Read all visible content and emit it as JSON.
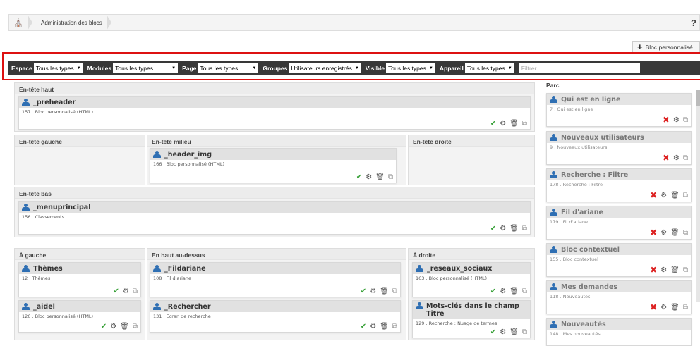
{
  "breadcrumb": {
    "item": "Administration des blocs",
    "help": "?"
  },
  "add_button": {
    "label": "Bloc personnalisé"
  },
  "filters": [
    {
      "label": "Espace",
      "value": "Tous les types"
    },
    {
      "label": "Modules",
      "value": "Tous les types"
    },
    {
      "label": "Page",
      "value": "Tous les types"
    },
    {
      "label": "Groupes",
      "value": "Utilisateurs enregistrés"
    },
    {
      "label": "Visible",
      "value": "Tous les types"
    },
    {
      "label": "Appareil",
      "value": "Tous les types"
    }
  ],
  "filter_placeholder": "Filtrer",
  "regions": {
    "top": "En-tête haut",
    "left_head": "En-tête gauche",
    "mid_head": "En-tête milieu",
    "right_head": "En-tête droite",
    "bottom_head": "En-tête bas",
    "left": "À gauche",
    "top_above": "En haut au-dessus",
    "right": "À droite",
    "parc": "Parc"
  },
  "blocks": {
    "preheader": {
      "title": "_preheader",
      "sub": "157 . Bloc personnalisé (HTML)"
    },
    "header_img": {
      "title": "_header_img",
      "sub": "166 . Bloc personnalisé (HTML)"
    },
    "menuprincipal": {
      "title": "_menuprincipal",
      "sub": "156 . Classements"
    },
    "themes": {
      "title": "Thèmes",
      "sub": "12 . Thèmes"
    },
    "aidel": {
      "title": "_aidel",
      "sub": "126 . Bloc personnalisé (HTML)"
    },
    "fildariane": {
      "title": "_Fildariane",
      "sub": "108 . Fil d'ariane"
    },
    "rechercher": {
      "title": "_Rechercher",
      "sub": "131 . Ecran de recherche"
    },
    "reseaux": {
      "title": "_reseaux_sociaux",
      "sub": "163 . Bloc personnalisé (HTML)"
    },
    "motscles": {
      "title": "Mots-clés dans le champ Titre",
      "sub": "129 . Recherche : Nuage de termes"
    }
  },
  "side": [
    {
      "title": "Qui est en ligne",
      "sub": "7 . Qui est en ligne"
    },
    {
      "title": "Nouveaux utilisateurs",
      "sub": "9 . Nouveaux utilisateurs"
    },
    {
      "title": "Recherche : Filtre",
      "sub": "178 . Recherche : Filtre"
    },
    {
      "title": "Fil d'ariane",
      "sub": "179 . Fil d'ariane"
    },
    {
      "title": "Bloc contextuel",
      "sub": "155 . Bloc contextuel"
    },
    {
      "title": "Mes demandes",
      "sub": "118 . Nouveautés"
    },
    {
      "title": "Nouveautés",
      "sub": "148 . Mes nouveautés"
    }
  ]
}
